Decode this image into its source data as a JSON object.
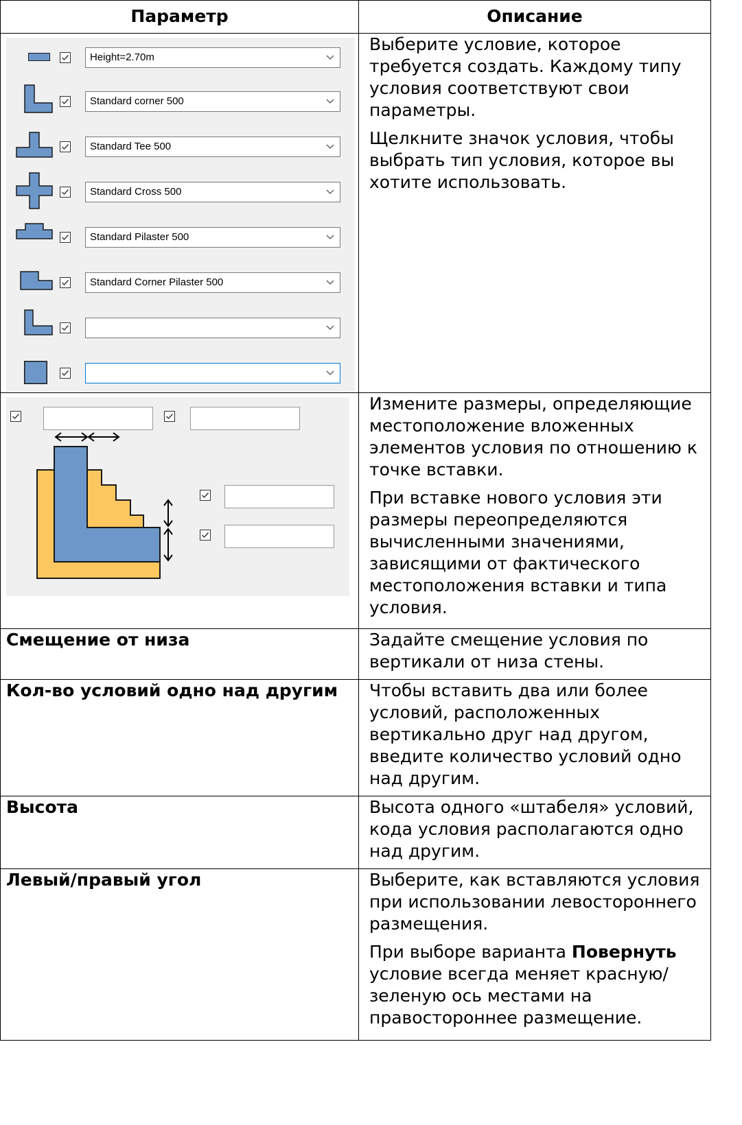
{
  "table": {
    "headers": {
      "param": "Параметр",
      "desc": "Описание"
    }
  },
  "conditions_panel": {
    "rows": [
      {
        "icon": "wall-end-icon",
        "value": "Height=2.70m",
        "checked": true
      },
      {
        "icon": "corner-icon",
        "value": "Standard corner 500",
        "checked": true
      },
      {
        "icon": "tee-icon",
        "value": "Standard Tee 500",
        "checked": true
      },
      {
        "icon": "cross-icon",
        "value": "Standard Cross 500",
        "checked": true
      },
      {
        "icon": "pilaster-icon",
        "value": "Standard Pilaster 500",
        "checked": true
      },
      {
        "icon": "corner-pilaster-icon",
        "value": "Standard Corner Pilaster 500",
        "checked": true
      },
      {
        "icon": "corner-icon",
        "value": "",
        "checked": true
      },
      {
        "icon": "square-icon",
        "value": "",
        "checked": true
      }
    ],
    "desc": [
      "Выберите условие, которое требуется создать. Каждому типу условия соответствуют свои параметры.",
      "Щелкните значок условия, чтобы выбрать тип условия, которое вы хотите использовать."
    ]
  },
  "dimensions_panel": {
    "fields": [
      "",
      "",
      "",
      ""
    ],
    "desc": [
      "Измените размеры, определяющие местоположение вложенных элементов условия по отношению к точке вставки.",
      "При вставке нового условия эти размеры переопределяются вычисленными значениями, зависящими от фактического местоположения вставки и типа условия."
    ],
    "colors": {
      "blue": "#6d97c9",
      "yellow": "#fcc75f"
    }
  },
  "rows": [
    {
      "param": "Смещение от низа",
      "desc": [
        "Задайте смещение условия по вертикали от низа стены."
      ]
    },
    {
      "param": "Кол-во условий одно над другим",
      "desc": [
        "Чтобы вставить два или более условий, расположенных вертикально друг над другом, введите количество условий одно над другим."
      ]
    },
    {
      "param": "Высота",
      "desc": [
        "Высота одного «штабеля» условий, кода условия располагаются одно над другим."
      ]
    },
    {
      "param": "Левый/правый угол",
      "desc": [
        "Выберите, как вставляются условия при использовании левостороннего размещения.",
        {
          "before": "При выборе варианта ",
          "bold": "Повернуть",
          "after": " условие всегда меняет красную/ зеленую ось местами на правостороннее размещение."
        }
      ]
    }
  ]
}
